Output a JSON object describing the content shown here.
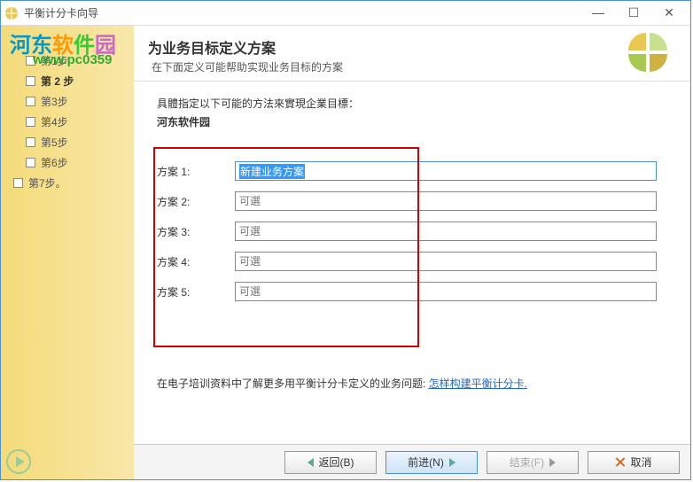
{
  "window": {
    "title": "平衡计分卡向导"
  },
  "watermark": {
    "text_parts": [
      "河东",
      "软",
      "件",
      "园"
    ],
    "url": "www.pc0359"
  },
  "sidebar": {
    "steps": [
      {
        "label": "第1步"
      },
      {
        "label": "第 2 步",
        "active": true
      },
      {
        "label": "第3步"
      },
      {
        "label": "第4步"
      },
      {
        "label": "第5步"
      },
      {
        "label": "第6步"
      },
      {
        "label": "第7步。",
        "last": true
      }
    ]
  },
  "header": {
    "title": "为业务目标定义方案",
    "subtitle": "在下面定义可能帮助实现业务目标的方案"
  },
  "main": {
    "instruction": "具體指定以下可能的方法來實現企業目標：",
    "org_name": "河东软件园",
    "fields": [
      {
        "label": "方案 1:",
        "value": "新建业务方案",
        "active": true
      },
      {
        "label": "方案 2:",
        "value": "",
        "placeholder": "可選"
      },
      {
        "label": "方案 3:",
        "value": "",
        "placeholder": "可選"
      },
      {
        "label": "方案 4:",
        "value": "",
        "placeholder": "可選"
      },
      {
        "label": "方案 5:",
        "value": "",
        "placeholder": "可選"
      }
    ],
    "help_text": "在电子培训资料中了解更多用平衡计分卡定义的业务问题: ",
    "help_link": "怎样构建平衡计分卡."
  },
  "footer": {
    "back": "返回(B)",
    "next": "前进(N)",
    "finish": "结束(F)",
    "cancel": "取消"
  }
}
